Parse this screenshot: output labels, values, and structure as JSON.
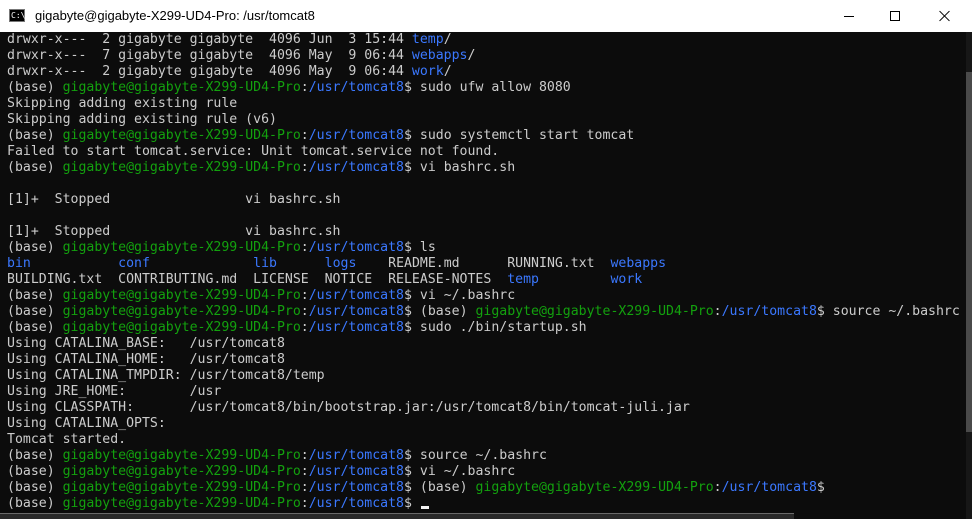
{
  "window": {
    "title": "gigabyte@gigabyte-X299-UD4-Pro: /usr/tomcat8",
    "icon_text": "C:\\",
    "controls": [
      "minimize",
      "maximize",
      "close"
    ]
  },
  "colors": {
    "background": "#0c0c0c",
    "text": "#cccccc",
    "user_host": "#13a10e",
    "path_and_dirs": "#3b78ff",
    "cursor": "#f2f2f2"
  },
  "terminal": {
    "lines": [
      [
        {
          "t": "drwxr-x---  2 gigabyte gigabyte  4096 Jun  3 15:44 "
        },
        {
          "t": "temp",
          "c": "b"
        },
        {
          "t": "/"
        }
      ],
      [
        {
          "t": "drwxr-x---  7 gigabyte gigabyte  4096 May  9 06:44 "
        },
        {
          "t": "webapps",
          "c": "b"
        },
        {
          "t": "/"
        }
      ],
      [
        {
          "t": "drwxr-x---  2 gigabyte gigabyte  4096 May  9 06:44 "
        },
        {
          "t": "work",
          "c": "b"
        },
        {
          "t": "/"
        }
      ],
      [
        {
          "t": "(base) "
        },
        {
          "t": "gigabyte@gigabyte-X299-UD4-Pro",
          "c": "g"
        },
        {
          "t": ":"
        },
        {
          "t": "/usr/tomcat8",
          "c": "b"
        },
        {
          "t": "$ sudo ufw allow 8080"
        }
      ],
      [
        {
          "t": "Skipping adding existing rule"
        }
      ],
      [
        {
          "t": "Skipping adding existing rule (v6)"
        }
      ],
      [
        {
          "t": "(base) "
        },
        {
          "t": "gigabyte@gigabyte-X299-UD4-Pro",
          "c": "g"
        },
        {
          "t": ":"
        },
        {
          "t": "/usr/tomcat8",
          "c": "b"
        },
        {
          "t": "$ sudo systemctl start tomcat"
        }
      ],
      [
        {
          "t": "Failed to start tomcat.service: Unit tomcat.service not found."
        }
      ],
      [
        {
          "t": "(base) "
        },
        {
          "t": "gigabyte@gigabyte-X299-UD4-Pro",
          "c": "g"
        },
        {
          "t": ":"
        },
        {
          "t": "/usr/tomcat8",
          "c": "b"
        },
        {
          "t": "$ vi bashrc.sh"
        }
      ],
      [
        {
          "t": ""
        }
      ],
      [
        {
          "t": "[1]+  Stopped                 vi bashrc.sh"
        }
      ],
      [
        {
          "t": ""
        }
      ],
      [
        {
          "t": "[1]+  Stopped                 vi bashrc.sh"
        }
      ],
      [
        {
          "t": "(base) "
        },
        {
          "t": "gigabyte@gigabyte-X299-UD4-Pro",
          "c": "g"
        },
        {
          "t": ":"
        },
        {
          "t": "/usr/tomcat8",
          "c": "b"
        },
        {
          "t": "$ ls"
        }
      ],
      [
        {
          "t": "bin",
          "c": "b"
        },
        {
          "t": "           "
        },
        {
          "t": "conf",
          "c": "b"
        },
        {
          "t": "             "
        },
        {
          "t": "lib",
          "c": "b"
        },
        {
          "t": "      "
        },
        {
          "t": "logs",
          "c": "b"
        },
        {
          "t": "    README.md      RUNNING.txt  "
        },
        {
          "t": "webapps",
          "c": "b"
        }
      ],
      [
        {
          "t": "BUILDING.txt  CONTRIBUTING.md  LICENSE  NOTICE  RELEASE-NOTES  "
        },
        {
          "t": "temp",
          "c": "b"
        },
        {
          "t": "         "
        },
        {
          "t": "work",
          "c": "b"
        }
      ],
      [
        {
          "t": "(base) "
        },
        {
          "t": "gigabyte@gigabyte-X299-UD4-Pro",
          "c": "g"
        },
        {
          "t": ":"
        },
        {
          "t": "/usr/tomcat8",
          "c": "b"
        },
        {
          "t": "$ vi ~/.bashrc"
        }
      ],
      [
        {
          "t": "(base) "
        },
        {
          "t": "gigabyte@gigabyte-X299-UD4-Pro",
          "c": "g"
        },
        {
          "t": ":"
        },
        {
          "t": "/usr/tomcat8",
          "c": "b"
        },
        {
          "t": "$ (base) "
        },
        {
          "t": "gigabyte@gigabyte-X299-UD4-Pro",
          "c": "g"
        },
        {
          "t": ":"
        },
        {
          "t": "/usr/tomcat8",
          "c": "b"
        },
        {
          "t": "$ source ~/.bashrc"
        }
      ],
      [
        {
          "t": "(base) "
        },
        {
          "t": "gigabyte@gigabyte-X299-UD4-Pro",
          "c": "g"
        },
        {
          "t": ":"
        },
        {
          "t": "/usr/tomcat8",
          "c": "b"
        },
        {
          "t": "$ sudo ./bin/startup.sh"
        }
      ],
      [
        {
          "t": "Using CATALINA_BASE:   /usr/tomcat8"
        }
      ],
      [
        {
          "t": "Using CATALINA_HOME:   /usr/tomcat8"
        }
      ],
      [
        {
          "t": "Using CATALINA_TMPDIR: /usr/tomcat8/temp"
        }
      ],
      [
        {
          "t": "Using JRE_HOME:        /usr"
        }
      ],
      [
        {
          "t": "Using CLASSPATH:       /usr/tomcat8/bin/bootstrap.jar:/usr/tomcat8/bin/tomcat-juli.jar"
        }
      ],
      [
        {
          "t": "Using CATALINA_OPTS:"
        }
      ],
      [
        {
          "t": "Tomcat started."
        }
      ],
      [
        {
          "t": "(base) "
        },
        {
          "t": "gigabyte@gigabyte-X299-UD4-Pro",
          "c": "g"
        },
        {
          "t": ":"
        },
        {
          "t": "/usr/tomcat8",
          "c": "b"
        },
        {
          "t": "$ source ~/.bashrc"
        }
      ],
      [
        {
          "t": "(base) "
        },
        {
          "t": "gigabyte@gigabyte-X299-UD4-Pro",
          "c": "g"
        },
        {
          "t": ":"
        },
        {
          "t": "/usr/tomcat8",
          "c": "b"
        },
        {
          "t": "$ vi ~/.bashrc"
        }
      ],
      [
        {
          "t": "(base) "
        },
        {
          "t": "gigabyte@gigabyte-X299-UD4-Pro",
          "c": "g"
        },
        {
          "t": ":"
        },
        {
          "t": "/usr/tomcat8",
          "c": "b"
        },
        {
          "t": "$ (base) "
        },
        {
          "t": "gigabyte@gigabyte-X299-UD4-Pro",
          "c": "g"
        },
        {
          "t": ":"
        },
        {
          "t": "/usr/tomcat8",
          "c": "b"
        },
        {
          "t": "$"
        }
      ],
      [
        {
          "t": "(base) "
        },
        {
          "t": "gigabyte@gigabyte-X299-UD4-Pro",
          "c": "g"
        },
        {
          "t": ":"
        },
        {
          "t": "/usr/tomcat8",
          "c": "b"
        },
        {
          "t": "$ "
        }
      ]
    ]
  }
}
